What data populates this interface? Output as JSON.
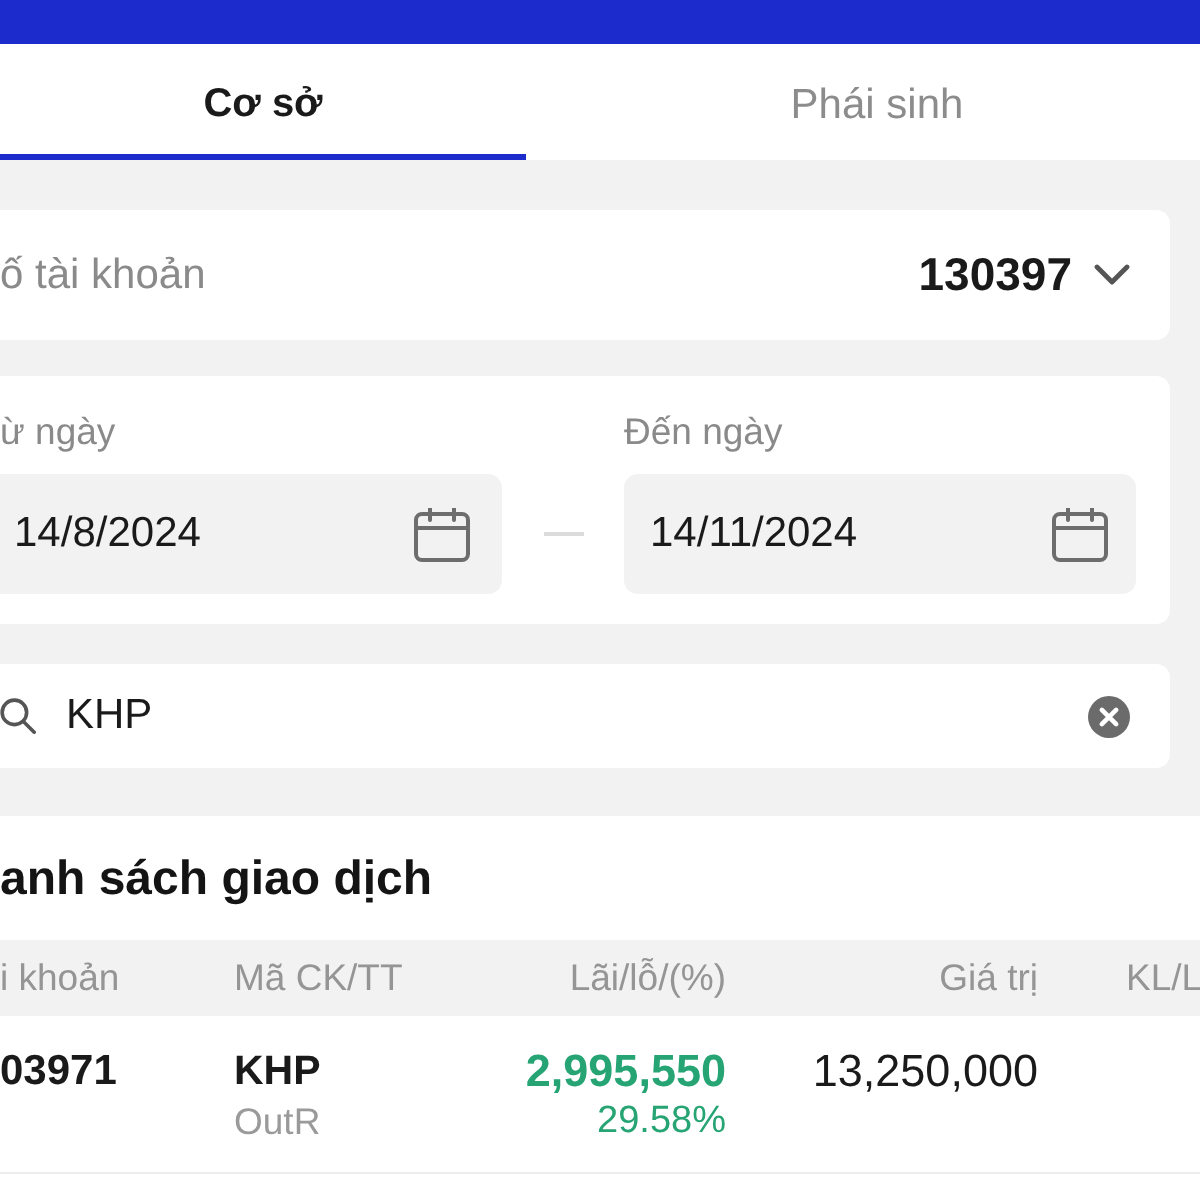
{
  "tabs": [
    {
      "label": "Cơ sở",
      "selected": true
    },
    {
      "label": "Phái sinh",
      "selected": false
    }
  ],
  "account": {
    "label": "ố tài khoản",
    "value": "130397"
  },
  "date_range": {
    "from": {
      "label": "ừ ngày",
      "value": "14/8/2024"
    },
    "to": {
      "label": "Đến ngày",
      "value": "14/11/2024"
    }
  },
  "search": {
    "value": "KHP"
  },
  "transactions": {
    "title": "anh sách giao dịch",
    "columns": [
      "i khoản",
      "Mã CK/TT",
      "Lãi/lỗ/(%)",
      "Giá trị",
      "KL/L"
    ],
    "rows": [
      {
        "account": "03971",
        "symbol": "KHP",
        "status": "OutR",
        "profit": "2,995,550",
        "profit_pct": "29.58%",
        "gain": true,
        "value": "13,250,000"
      }
    ]
  }
}
